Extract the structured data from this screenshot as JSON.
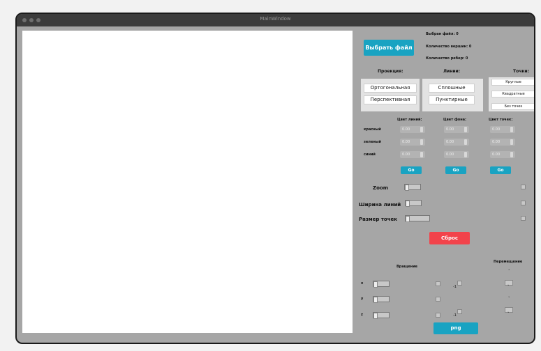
{
  "window": {
    "title": "MainWindow"
  },
  "file": {
    "choose_button": "Выбрать файл",
    "selected": "Выбран файл: 0",
    "vertices": "Количество вершин: 0",
    "edges": "Количество ребер: 0"
  },
  "projection": {
    "header": "Проекция:",
    "ortho": "Ортогональная",
    "persp": "Перспективная"
  },
  "lines": {
    "header": "Линии:",
    "solid": "Сплошные",
    "dashed": "Пунктирные"
  },
  "points": {
    "header": "Точки:",
    "round": "Круглые",
    "square": "Квадратные",
    "none": "Без точек"
  },
  "colors": {
    "line_header": "Цвет линий:",
    "bg_header": "Цвет фона:",
    "point_header": "Цвет точек:",
    "red": "красный",
    "green": "зеленый",
    "blue": "синий",
    "value": "0.00",
    "go": "Go"
  },
  "sliders": {
    "zoom": "Zoom",
    "line_width": "Ширина линий",
    "point_size": "Размер точек"
  },
  "reset": "Сброс",
  "transform": {
    "rotation": "Вращение",
    "move": "Перемещение",
    "x": "x",
    "y": "y",
    "z": "z",
    "minus": "-1"
  },
  "export_png": "png"
}
